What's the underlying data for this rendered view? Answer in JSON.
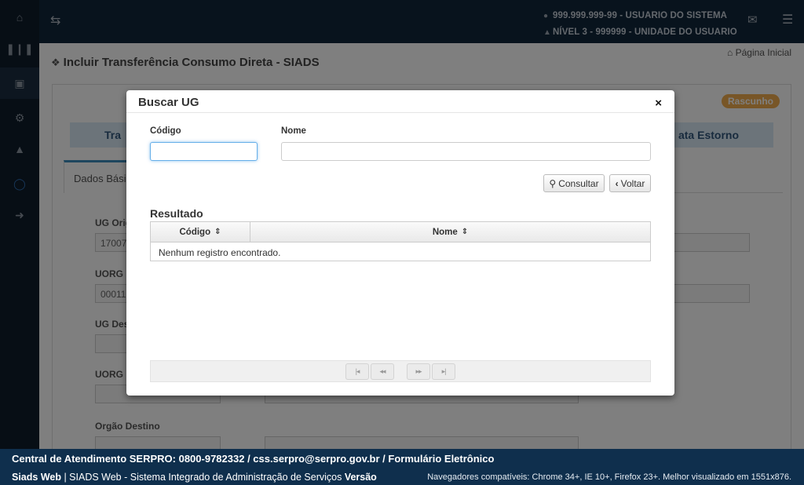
{
  "topbar": {
    "user_line": "999.999.999-99 - USUARIO DO SISTEMA",
    "unit_line": "NÍVEL 3 - 999999 - UNIDADE DO USUARIO"
  },
  "page": {
    "title": "Incluir Transferência Consumo Direta - SIADS",
    "home_link": "Página Inicial",
    "status_badge": "Rascunho",
    "step_left": "Tra",
    "step_right": "ata Estorno",
    "tab_label": "Dados Básic",
    "fields": [
      {
        "label": "UG Orig",
        "value": "17007"
      },
      {
        "label": "UORG",
        "value": "00011"
      },
      {
        "label": "UG Des",
        "value": ""
      },
      {
        "label": "UORG",
        "value": ""
      },
      {
        "label": "Orgão Destino",
        "value": ""
      }
    ]
  },
  "modal": {
    "title": "Buscar UG",
    "close_symbol": "×",
    "codigo_label": "Código",
    "nome_label": "Nome",
    "consultar_label": "Consultar",
    "voltar_label": "Voltar",
    "result_title": "Resultado",
    "columns": [
      "Código",
      "Nome"
    ],
    "empty_message": "Nenhum registro encontrado.",
    "pager": [
      "|◂",
      "◂◂",
      "▸▸",
      "▸|"
    ]
  },
  "footer": {
    "line1": "Central de Atendimento SERPRO: 0800-9782332 / css.serpro@serpro.gov.br / Formulário Eletrônico",
    "brand": "Siads Web",
    "system": " | SIADS Web - Sistema Integrado de Administração de Serviços ",
    "version_label": "Versão",
    "browsers": "Navegadores compatíveis: Chrome 34+, IE 10+, Firefox 23+. Melhor visualizado em 1551x876."
  },
  "icons": {
    "home": "home-icon",
    "barcode": "barcode-icon",
    "archive": "archive-icon",
    "cogs": "cogs-icon",
    "graduation": "graduation-cap-icon",
    "circle": "circle-icon",
    "sign_in": "sign-in-icon",
    "exchange": "exchange-icon",
    "user": "user-icon",
    "sitemap": "sitemap-icon",
    "envelope": "envelope-icon",
    "bars": "bars-icon",
    "search": "search-icon",
    "chevron_left": "chevron-left-icon"
  },
  "colors": {
    "sidebar": "#0f1c2a",
    "topbar": "#10263b",
    "footer": "#0f2f4d",
    "badge": "#f0ad4e",
    "focus": "#66afe9"
  }
}
